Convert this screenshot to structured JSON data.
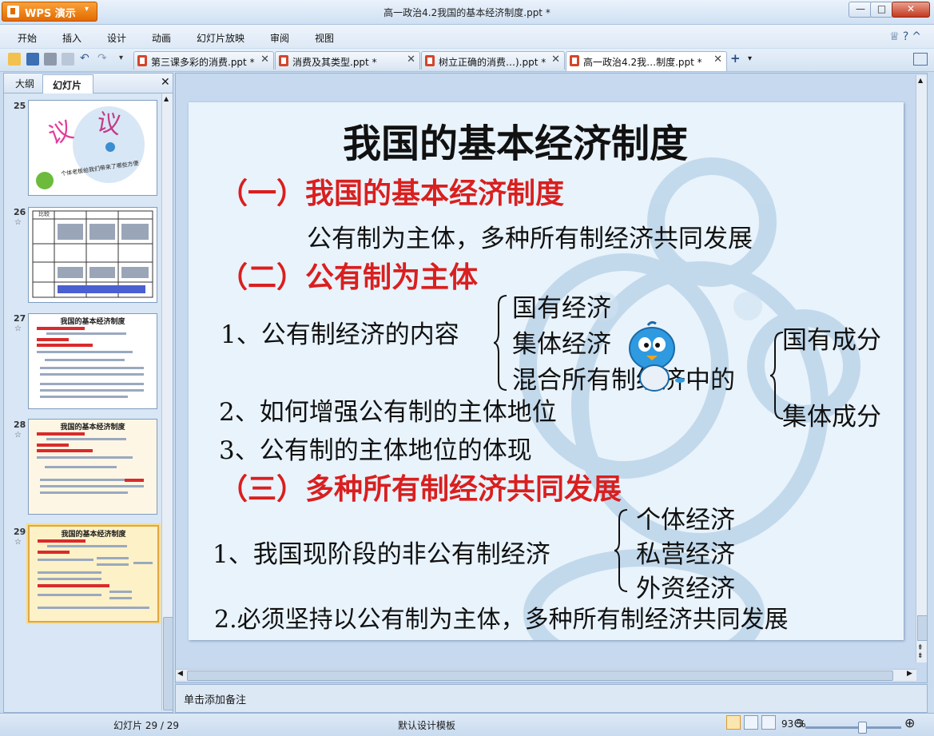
{
  "app": {
    "name": "WPS 演示",
    "window_title": "高一政治4.2我国的基本经济制度.ppt *"
  },
  "window_controls": {
    "minimize": "—",
    "maximize": "□",
    "close": "✕"
  },
  "menu": [
    "开始",
    "插入",
    "设计",
    "动画",
    "幻灯片放映",
    "审阅",
    "视图"
  ],
  "menu_right_icons": [
    "shirt-icon",
    "help-icon",
    "collapse-icon"
  ],
  "tabs": [
    {
      "label": "第三课多彩的消费.ppt *",
      "active": false
    },
    {
      "label": "消费及其类型.ppt *",
      "active": false
    },
    {
      "label": "树立正确的消费…).ppt *",
      "active": false
    },
    {
      "label": "高一政治4.2我…制度.ppt *",
      "active": true
    }
  ],
  "new_tab": "+",
  "left_pane": {
    "tabs": [
      "大纲",
      "幻灯片"
    ],
    "active_tab": "幻灯片",
    "close": "✕",
    "thumbnails": [
      {
        "number": "25",
        "star": "",
        "title": "",
        "caption": "个体老板给我们带来了哪些方便"
      },
      {
        "number": "26",
        "star": "☆",
        "title": "",
        "caption": "比较"
      },
      {
        "number": "27",
        "star": "☆",
        "title": "我国的基本经济制度",
        "caption": ""
      },
      {
        "number": "28",
        "star": "☆",
        "title": "我国的基本经济制度",
        "caption": ""
      },
      {
        "number": "29",
        "star": "☆",
        "title": "我国的基本经济制度",
        "caption": "",
        "selected": true
      }
    ]
  },
  "slide": {
    "title": "我国的基本经济制度",
    "section1": "（一）我国的基本经济制度",
    "section1_body": "公有制为主体，多种所有制经济共同发展",
    "section2": "（二）公有制为主体",
    "item1": "1、公有制经济的内容",
    "item1_options": [
      "国有经济",
      "集体经济",
      "混合所有制经济中的"
    ],
    "item1_sub": [
      "国有成分",
      "集体成分"
    ],
    "item2": "2、如何增强公有制的主体地位",
    "item3": "3、公有制的主体地位的体现",
    "section3": "（三）多种所有制经济共同发展",
    "item4": "1、我国现阶段的非公有制经济",
    "item4_options": [
      "个体经济",
      "私营经济",
      "外资经济"
    ],
    "item5": "2.必须坚持以公有制为主体，多种所有制经济共同发展"
  },
  "notes_placeholder": "单击添加备注",
  "status": {
    "slide_counter": "幻灯片 29 / 29",
    "template": "默认设计模板",
    "zoom": "93 %"
  },
  "colors": {
    "accent_red": "#d91f1f",
    "app_orange": "#e36a00",
    "chrome_blue": "#c9dcf0"
  }
}
